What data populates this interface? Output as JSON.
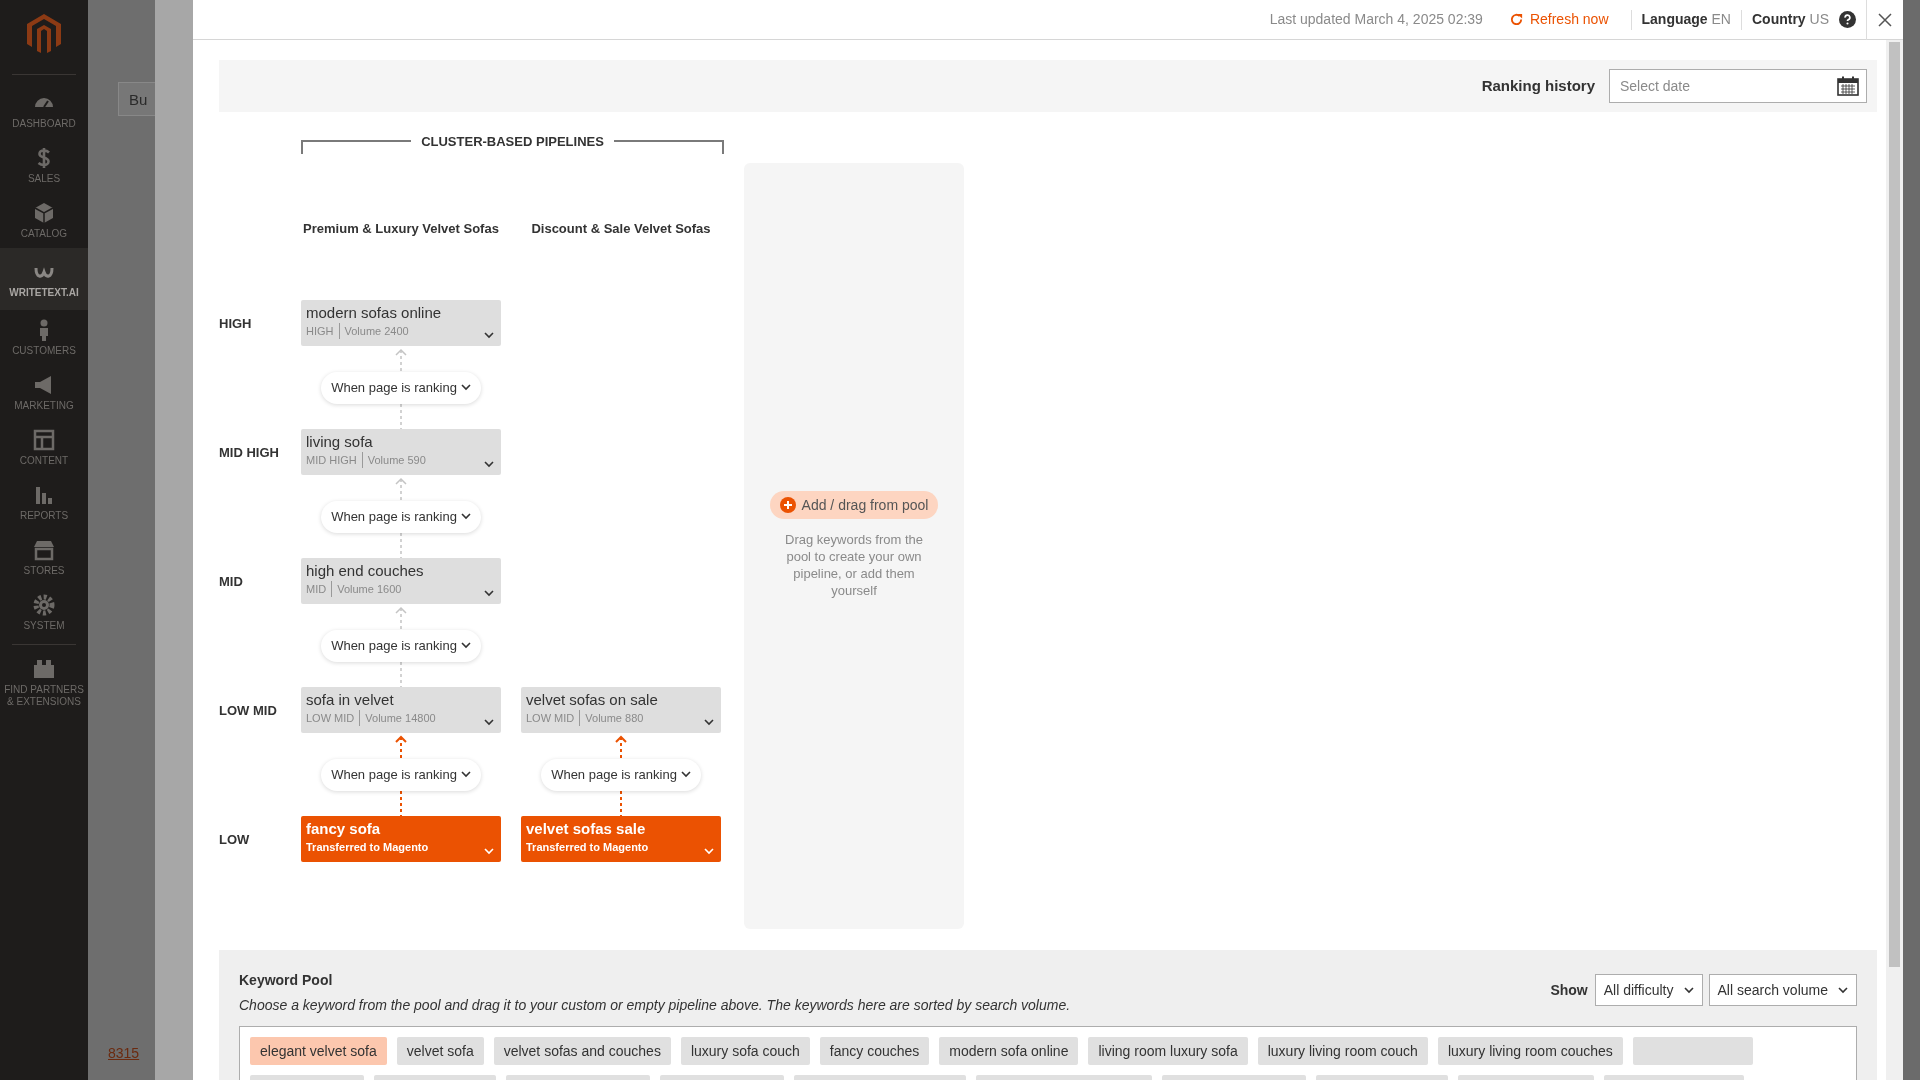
{
  "sidebar": {
    "items": [
      {
        "label": "DASHBOARD",
        "selected": false
      },
      {
        "label": "SALES",
        "selected": false
      },
      {
        "label": "CATALOG",
        "selected": false
      },
      {
        "label": "WRITETEXT.AI",
        "selected": true
      },
      {
        "label": "CUSTOMERS",
        "selected": false
      },
      {
        "label": "MARKETING",
        "selected": false
      },
      {
        "label": "CONTENT",
        "selected": false
      },
      {
        "label": "REPORTS",
        "selected": false
      },
      {
        "label": "STORES",
        "selected": false
      },
      {
        "label": "SYSTEM",
        "selected": false
      },
      {
        "label": "FIND PARTNERS & EXTENSIONS",
        "selected": false
      }
    ]
  },
  "background": {
    "button": "Bu",
    "link": "8315"
  },
  "topbar": {
    "last_updated": "Last updated March 4, 2025 02:39",
    "refresh": "Refresh now",
    "language_label": "Language",
    "language": "EN",
    "country_label": "Country",
    "country": "US"
  },
  "ranking_history": {
    "label": "Ranking history",
    "placeholder": "Select date"
  },
  "pipelines": {
    "title": "CLUSTER-BASED PIPELINES",
    "levels": [
      "HIGH",
      "MID HIGH",
      "MID",
      "LOW MID",
      "LOW"
    ],
    "columns": [
      {
        "name": "Premium & Luxury Velvet Sofas",
        "cards": [
          {
            "keyword": "modern sofas online",
            "transferred": false,
            "difficulty": "HIGH",
            "volume": "Volume 2400"
          },
          {
            "keyword": "living sofa",
            "transferred": false,
            "difficulty": "MID HIGH",
            "volume": "Volume 590",
            "trigger": {
              "label": "When page is ranking",
              "active": false
            }
          },
          {
            "keyword": "high end couches",
            "transferred": false,
            "difficulty": "MID",
            "volume": "Volume 1600",
            "trigger": {
              "label": "When page is ranking",
              "active": false
            }
          },
          {
            "keyword": "sofa in velvet",
            "transferred": false,
            "difficulty": "LOW MID",
            "volume": "Volume 14800",
            "trigger": {
              "label": "When page is ranking",
              "active": false
            }
          },
          {
            "keyword": "fancy sofa",
            "transferred": true,
            "status": "Transferred to Magento",
            "trigger": {
              "label": "When page is ranking",
              "active": true
            }
          }
        ]
      },
      {
        "name": "Discount & Sale Velvet Sofas",
        "cards": [
          {
            "keyword": "velvet sofas on sale",
            "transferred": false,
            "difficulty": "LOW MID",
            "volume": "Volume 880"
          },
          {
            "keyword": "velvet sofas sale",
            "transferred": true,
            "status": "Transferred to Magento",
            "trigger": {
              "label": "When page is ranking",
              "active": true
            }
          }
        ]
      }
    ],
    "empty_column": {
      "button": "Add / drag from pool",
      "hint": "Drag keywords from the pool to create your own pipeline, or add them yourself"
    }
  },
  "keyword_pool": {
    "title": "Keyword Pool",
    "description": "Choose a keyword from the pool and drag it to your custom or empty pipeline above. The keywords here are sorted by search volume.",
    "show_label": "Show",
    "filters": [
      "All difficulty",
      "All search volume"
    ],
    "keywords": [
      {
        "label": "elegant velvet sofa",
        "selected": true
      },
      {
        "label": "velvet sofa",
        "selected": false
      },
      {
        "label": "velvet sofas and couches",
        "selected": false
      },
      {
        "label": "luxury sofa couch",
        "selected": false
      },
      {
        "label": "fancy couches",
        "selected": false
      },
      {
        "label": "modern sofa online",
        "selected": false
      },
      {
        "label": "living room luxury sofa",
        "selected": false
      },
      {
        "label": "luxury living room couch",
        "selected": false
      },
      {
        "label": "luxury living room couches",
        "selected": false
      }
    ]
  }
}
